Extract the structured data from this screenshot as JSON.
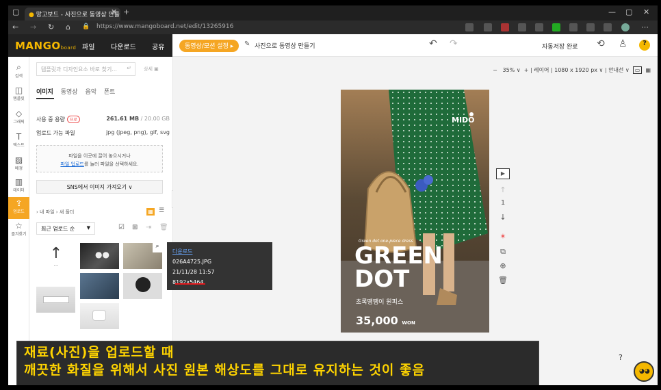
{
  "browser": {
    "tab_title": "망고보드 - 사진으로 동영상 만들",
    "url_host": "https://www.mangoboard.net",
    "url_path": "/edit/13265916"
  },
  "app": {
    "logo_main": "MANGO",
    "logo_sub": "board",
    "menu": [
      "파일",
      "다운로드",
      "공유"
    ],
    "video_setting": "동영상/모션 설정 ▸",
    "doc_title": "사진으로 동영상 만들기",
    "autosave": "자동저장 완료"
  },
  "sidebar": {
    "items": [
      {
        "label": "검색",
        "icon": "search-icon",
        "glyph": "⌕"
      },
      {
        "label": "템플릿",
        "icon": "template-icon",
        "glyph": "◫"
      },
      {
        "label": "그래픽",
        "icon": "graphic-icon",
        "glyph": "◇"
      },
      {
        "label": "텍스트",
        "icon": "text-icon",
        "glyph": "T"
      },
      {
        "label": "배경",
        "icon": "background-icon",
        "glyph": "▨"
      },
      {
        "label": "데이터",
        "icon": "data-icon",
        "glyph": "▥"
      },
      {
        "label": "업로드",
        "icon": "upload-icon",
        "glyph": "⇪"
      },
      {
        "label": "즐겨찾기",
        "icon": "star-icon",
        "glyph": "☆"
      }
    ]
  },
  "panel": {
    "search_placeholder": "템플릿과 디자인요소 바로 찾기...",
    "detail": "상세",
    "tabs": [
      "이미지",
      "동영상",
      "음악",
      "폰트"
    ],
    "usage_label": "사용 중 용량",
    "usage_badge": "프로",
    "usage_value": "261.61 MB",
    "usage_total": " / 20.00 GB",
    "file_types_label": "업로드 가능 파일",
    "file_types_value": "jpg (jpeg, png), gif, svg",
    "drop_line1": "파일을 이곳에 끌어 놓으시거나",
    "drop_link": "파일 업로드",
    "drop_line2": "를 눌러 파일을 선택하세요.",
    "sns_import": "SNS에서 이미지 가져오기 ∨",
    "breadcrumb": "› 내 파일 › 새 폴더",
    "sort": "최근 업로드 순",
    "upload_arrow": "↑",
    "upload_dots": "..."
  },
  "tooltip": {
    "download": "다운로드",
    "filename": "026A4725.JPG",
    "date": "21/11/28 11:57",
    "size": "8192x5464"
  },
  "canvas": {
    "zoom": "35%",
    "layer": "레이어",
    "dimensions": "1080 x 1920 px",
    "guides": "안내선"
  },
  "poster": {
    "brand": "MIDO",
    "script": "Green dot one-piece dress",
    "title1": "GREEN",
    "title2": "DOT",
    "subtitle": "초록땡땡이 원피스",
    "price": "35,000",
    "currency": "WON"
  },
  "page_tools": {
    "page_number": "1"
  },
  "caption": {
    "line1": "재료(사진)을 업로드할 때",
    "line2": "깨끗한 화질을 위해서 사진 원본 해상도를 그대로 유지하는 것이 좋음"
  },
  "colors": {
    "accent": "#f5a623",
    "caption_text": "#ffd400",
    "highlight_line": "#e3171b"
  }
}
